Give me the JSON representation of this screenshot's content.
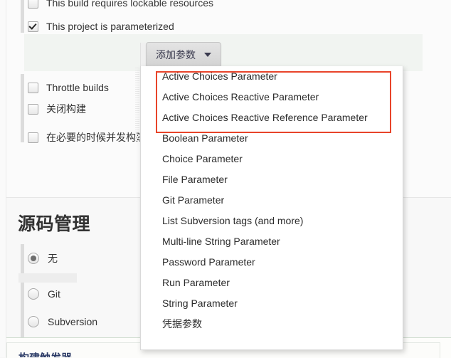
{
  "checkboxes": [
    {
      "label": "This build requires lockable resources",
      "checked": false,
      "clipped": true
    },
    {
      "label": "This project is parameterized",
      "checked": true
    },
    {
      "label": "Throttle builds",
      "checked": false
    },
    {
      "label": "关闭构建",
      "checked": false
    },
    {
      "label": "在必要的时候并发构建",
      "checked": false
    }
  ],
  "add_parameter_button": {
    "label": "添加参数",
    "caret_icon": "chevron-down-icon"
  },
  "dropdown": {
    "highlighted_count": 3,
    "highlight_color": "#e8442a",
    "items": [
      "Active Choices Parameter",
      "Active Choices Reactive Parameter",
      "Active Choices Reactive Reference Parameter",
      "Boolean Parameter",
      "Choice Parameter",
      "File Parameter",
      "Git Parameter",
      "List Subversion tags (and more)",
      "Multi-line String Parameter",
      "Password Parameter",
      "Run Parameter",
      "String Parameter",
      "凭据参数"
    ]
  },
  "scm": {
    "title": "源码管理",
    "options": [
      {
        "label": "无",
        "selected": true
      },
      {
        "label": "Git",
        "selected": false
      },
      {
        "label": "Subversion",
        "selected": false
      }
    ]
  },
  "bottom_panel": {
    "text": "构建触发器"
  }
}
